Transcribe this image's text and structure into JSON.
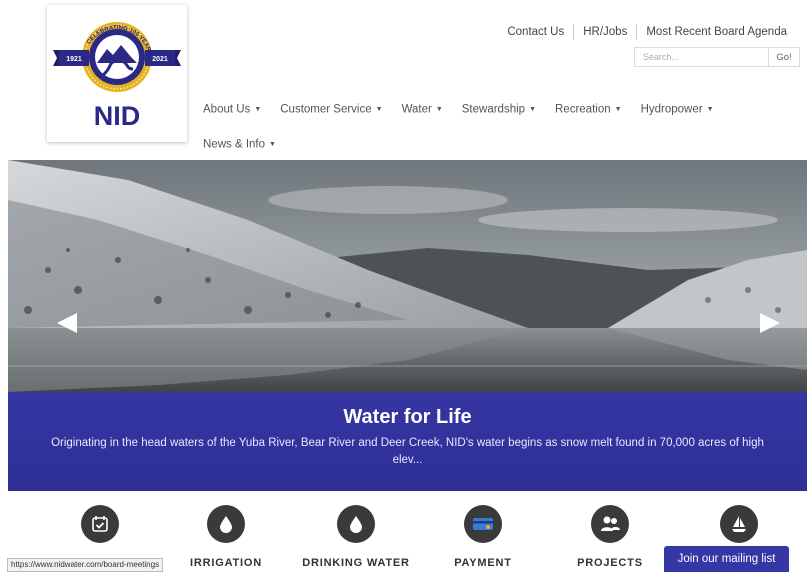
{
  "logo": {
    "name": "NID",
    "ribbon_text": "CELEBRATING 100 YEARS",
    "year_left": "1921",
    "year_right": "2021",
    "colors": {
      "navy": "#2a2a86",
      "gold": "#e6b321"
    }
  },
  "top_links": [
    "Contact Us",
    "HR/Jobs",
    "Most Recent Board Agenda"
  ],
  "search": {
    "placeholder": "Search...",
    "button": "Go!"
  },
  "nav": {
    "items": [
      "About Us",
      "Customer Service",
      "Water",
      "Stewardship",
      "Recreation",
      "Hydropower",
      "News & Info"
    ]
  },
  "hero": {
    "title": "Water for Life",
    "text": "Originating in the head waters of the Yuba River, Bear River and Deer Creek, NID's water begins as snow melt found in 70,000 acres of high elev...",
    "prev_icon": "left-arrow-icon",
    "next_icon": "right-arrow-icon",
    "caption_color": "#3536a3"
  },
  "quick_links": [
    {
      "label": "",
      "icon": "calendar-check-icon"
    },
    {
      "label": "IRRIGATION",
      "icon": "water-drop-icon"
    },
    {
      "label": "DRINKING WATER",
      "icon": "water-drop-icon"
    },
    {
      "label": "PAYMENT",
      "icon": "payment-card-icon"
    },
    {
      "label": "PROJECTS",
      "icon": "people-icon"
    },
    {
      "label": "",
      "icon": "sailboat-icon"
    }
  ],
  "status_url": "https://www.nidwater.com/board-meetings",
  "mailing_list": "Join our mailing list"
}
